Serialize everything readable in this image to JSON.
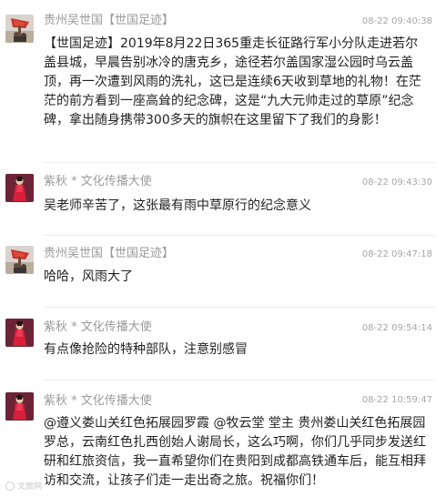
{
  "comments": [
    {
      "author": "贵州吴世国【世国足迹】",
      "time": "08-22 09:40:38",
      "avatar_icon": "red-flag-avatar-icon",
      "text": "【世国足迹】2019年8月22日365重走长征路行军小分队走进若尔盖县城，早晨告别冰冷的唐克乡，途径若尔盖国家湿公园时乌云盖顶，再一次遭到风雨的洗礼，这已是连续6天收到草地的礼物！在茫茫的前方看到一座高耸的纪念碑，这是“九大元帅走过的草原”纪念碑，拿出随身携带300多天的旗帜在这里留下了我们的身影！"
    },
    {
      "author": "紫秋 * 文化传播大使",
      "time": "08-22 09:43:30",
      "avatar_icon": "woman-red-dress-avatar-icon",
      "text": "吴老师辛苦了，这张最有雨中草原行的纪念意义"
    },
    {
      "author": "贵州吴世国【世国足迹】",
      "time": "08-22 09:47:18",
      "avatar_icon": "red-flag-avatar-icon",
      "text": "哈哈，风雨大了"
    },
    {
      "author": "紫秋 * 文化传播大使",
      "time": "08-22 09:54:14",
      "avatar_icon": "woman-red-dress-avatar-icon",
      "text": "有点像抢险的特种部队，注意别感冒"
    },
    {
      "author": "紫秋 * 文化传播大使",
      "time": "08-22 10:59:47",
      "avatar_icon": "woman-red-dress-avatar-icon",
      "text": "@遵义娄山关红色拓展园罗霞 @牧云堂  堂主 贵州娄山关红色拓展园罗总，云南红色扎西创始人谢局长，这么巧啊，你们几乎同步发送红研和红旅资信，我一直希望你们在贵阳到成都高铁通车后，能互相拜访和交流，让孩子们走一走出奇之旅。祝福你们！"
    }
  ],
  "watermark": "文旅网",
  "colors": {
    "name": "#9a9a9a",
    "time": "#a6a6a6",
    "text": "#222222"
  }
}
